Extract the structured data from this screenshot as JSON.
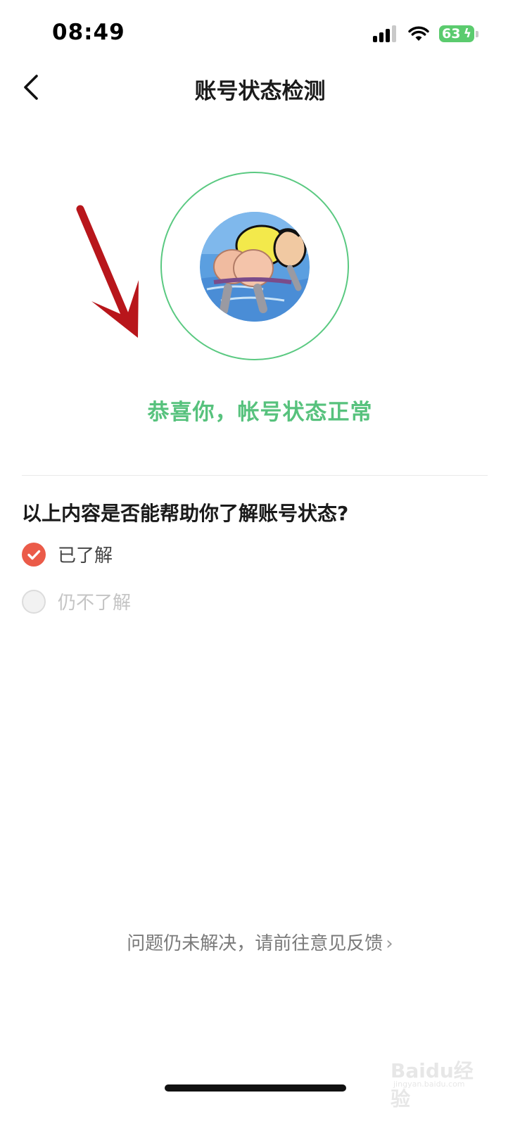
{
  "status_bar": {
    "time": "08:49",
    "battery_level": "63",
    "signal_bars": 3
  },
  "header": {
    "title": "账号状态检测",
    "back_icon": "chevron-left-icon"
  },
  "result": {
    "message": "恭喜你，帐号状态正常",
    "color": "#57c27d"
  },
  "survey": {
    "question": "以上内容是否能帮助你了解账号状态?",
    "options": [
      {
        "label": "已了解",
        "selected": true
      },
      {
        "label": "仍不了解",
        "selected": false
      }
    ],
    "accent_color": "#eb5b49"
  },
  "footer": {
    "feedback_link": "问题仍未解决，请前往意见反馈",
    "chevron_icon": "chevron-right-icon"
  },
  "watermark": {
    "brand": "Baidu经验",
    "sub": "jingyan.baidu.com"
  }
}
